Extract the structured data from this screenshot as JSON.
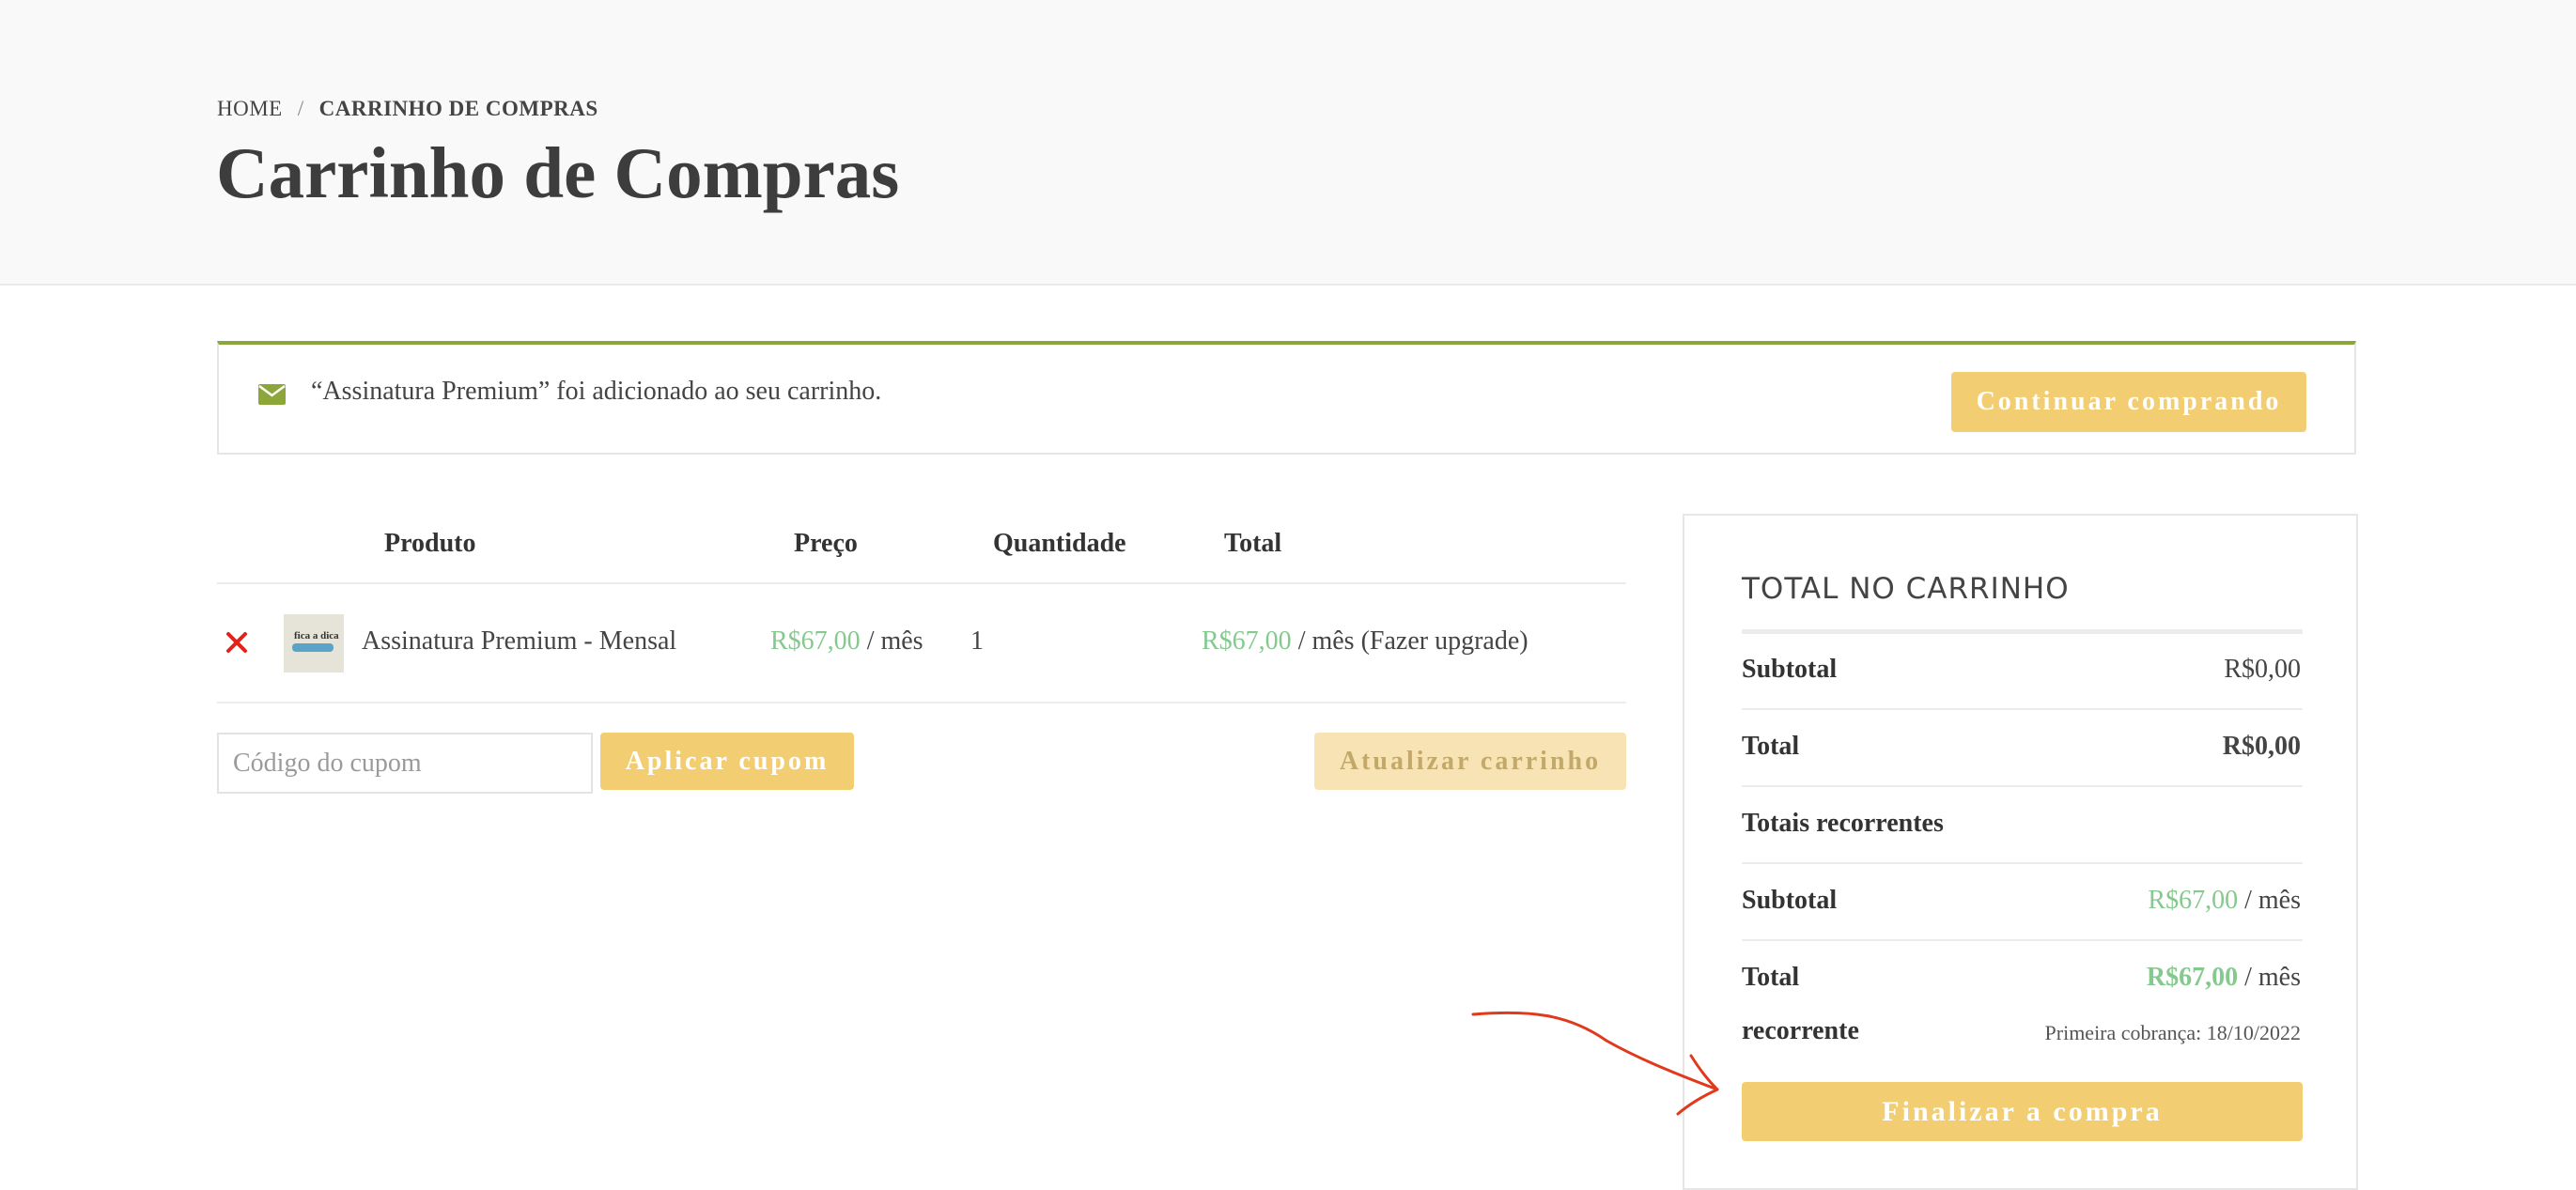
{
  "breadcrumb": {
    "home": "HOME",
    "separator": "/",
    "current": "CARRINHO DE COMPRAS"
  },
  "page_title": "Carrinho de Compras",
  "notice": {
    "icon": "envelope-icon",
    "message": "“Assinatura Premium” foi adicionado ao seu carrinho.",
    "button": "Continuar comprando"
  },
  "cart": {
    "headers": {
      "product": "Produto",
      "price": "Preço",
      "quantity": "Quantidade",
      "total": "Total"
    },
    "item": {
      "name": "Assinatura Premium - Mensal",
      "thumb_text": "fica a dica",
      "price": "R$67,00",
      "price_period": "/ mês",
      "quantity": "1",
      "total": "R$67,00",
      "total_suffix": "/ mês (Fazer upgrade)"
    },
    "coupon_placeholder": "Código do cupom",
    "apply_coupon": "Aplicar cupom",
    "update_cart": "Atualizar carrinho"
  },
  "totals": {
    "title": "TOTAL NO CARRINHO",
    "subtotal_label": "Subtotal",
    "subtotal_value": "R$0,00",
    "total_label": "Total",
    "total_value": "R$0,00",
    "recurring_heading": "Totais recorrentes",
    "recurring_subtotal_label": "Subtotal",
    "recurring_subtotal_value": "R$67,00",
    "recurring_subtotal_period": "/ mês",
    "recurring_total_label_1": "Total",
    "recurring_total_label_2": "recorrente",
    "recurring_total_value": "R$67,00",
    "recurring_total_period": "/ mês",
    "first_charge": "Primeira cobrança: 18/10/2022",
    "checkout": "Finalizar a compra"
  },
  "colors": {
    "accent_button": "#f2cd72",
    "price_green": "#86c98f",
    "notice_border": "#8ca63a",
    "remove_red": "#e2231a",
    "annotation_arrow": "#e0391c"
  }
}
